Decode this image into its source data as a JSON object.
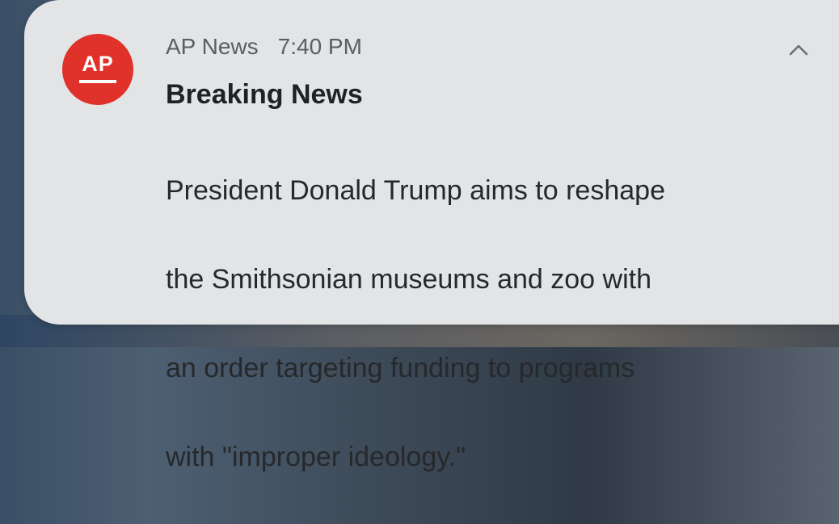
{
  "notification": {
    "app_name": "AP News",
    "time": "7:40 PM",
    "title": "Breaking News",
    "body_lines": [
      "President Donald Trump aims to reshape",
      "the Smithsonian museums and zoo with",
      "an order targeting funding to programs",
      "with \"improper ideology.\""
    ],
    "icon": {
      "logo_text": "AP",
      "name": "ap-logo-icon",
      "color": "#e0312b"
    },
    "collapse_icon": "chevron-up-icon"
  }
}
